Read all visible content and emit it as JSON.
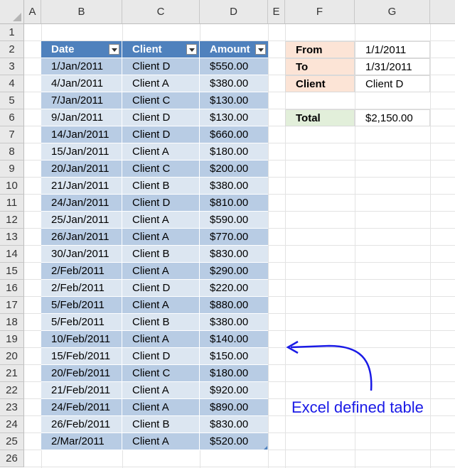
{
  "columns": [
    "A",
    "B",
    "C",
    "D",
    "E",
    "F",
    "G"
  ],
  "rows": [
    "1",
    "2",
    "3",
    "4",
    "5",
    "6",
    "7",
    "8",
    "9",
    "10",
    "11",
    "12",
    "13",
    "14",
    "15",
    "16",
    "17",
    "18",
    "19",
    "20",
    "21",
    "22",
    "23",
    "24",
    "25",
    "26"
  ],
  "table": {
    "headers": [
      "Date",
      "Client",
      "Amount"
    ],
    "data": [
      [
        "1/Jan/2011",
        "Client D",
        "$550.00"
      ],
      [
        "4/Jan/2011",
        "Client A",
        "$380.00"
      ],
      [
        "7/Jan/2011",
        "Client C",
        "$130.00"
      ],
      [
        "9/Jan/2011",
        "Client D",
        "$130.00"
      ],
      [
        "14/Jan/2011",
        "Client D",
        "$660.00"
      ],
      [
        "15/Jan/2011",
        "Client A",
        "$180.00"
      ],
      [
        "20/Jan/2011",
        "Client C",
        "$200.00"
      ],
      [
        "21/Jan/2011",
        "Client B",
        "$380.00"
      ],
      [
        "24/Jan/2011",
        "Client D",
        "$810.00"
      ],
      [
        "25/Jan/2011",
        "Client A",
        "$590.00"
      ],
      [
        "26/Jan/2011",
        "Client A",
        "$770.00"
      ],
      [
        "30/Jan/2011",
        "Client B",
        "$830.00"
      ],
      [
        "2/Feb/2011",
        "Client A",
        "$290.00"
      ],
      [
        "2/Feb/2011",
        "Client D",
        "$220.00"
      ],
      [
        "5/Feb/2011",
        "Client A",
        "$880.00"
      ],
      [
        "5/Feb/2011",
        "Client B",
        "$380.00"
      ],
      [
        "10/Feb/2011",
        "Client A",
        "$140.00"
      ],
      [
        "15/Feb/2011",
        "Client D",
        "$150.00"
      ],
      [
        "20/Feb/2011",
        "Client C",
        "$180.00"
      ],
      [
        "21/Feb/2011",
        "Client A",
        "$920.00"
      ],
      [
        "24/Feb/2011",
        "Client A",
        "$890.00"
      ],
      [
        "26/Feb/2011",
        "Client B",
        "$830.00"
      ],
      [
        "2/Mar/2011",
        "Client A",
        "$520.00"
      ]
    ]
  },
  "criteria": {
    "from_label": "From",
    "from_value": "1/1/2011",
    "to_label": "To",
    "to_value": "1/31/2011",
    "client_label": "Client",
    "client_value": "Client D",
    "total_label": "Total",
    "total_value": "$2,150.00"
  },
  "annotation": {
    "text": "Excel defined table",
    "color": "#1a1ae6"
  },
  "colors": {
    "header": "#4f81bd",
    "band_dark": "#b8cce4",
    "band_light": "#dce6f1",
    "criteria_label": "#fce4d6",
    "total_label": "#e2efda"
  }
}
